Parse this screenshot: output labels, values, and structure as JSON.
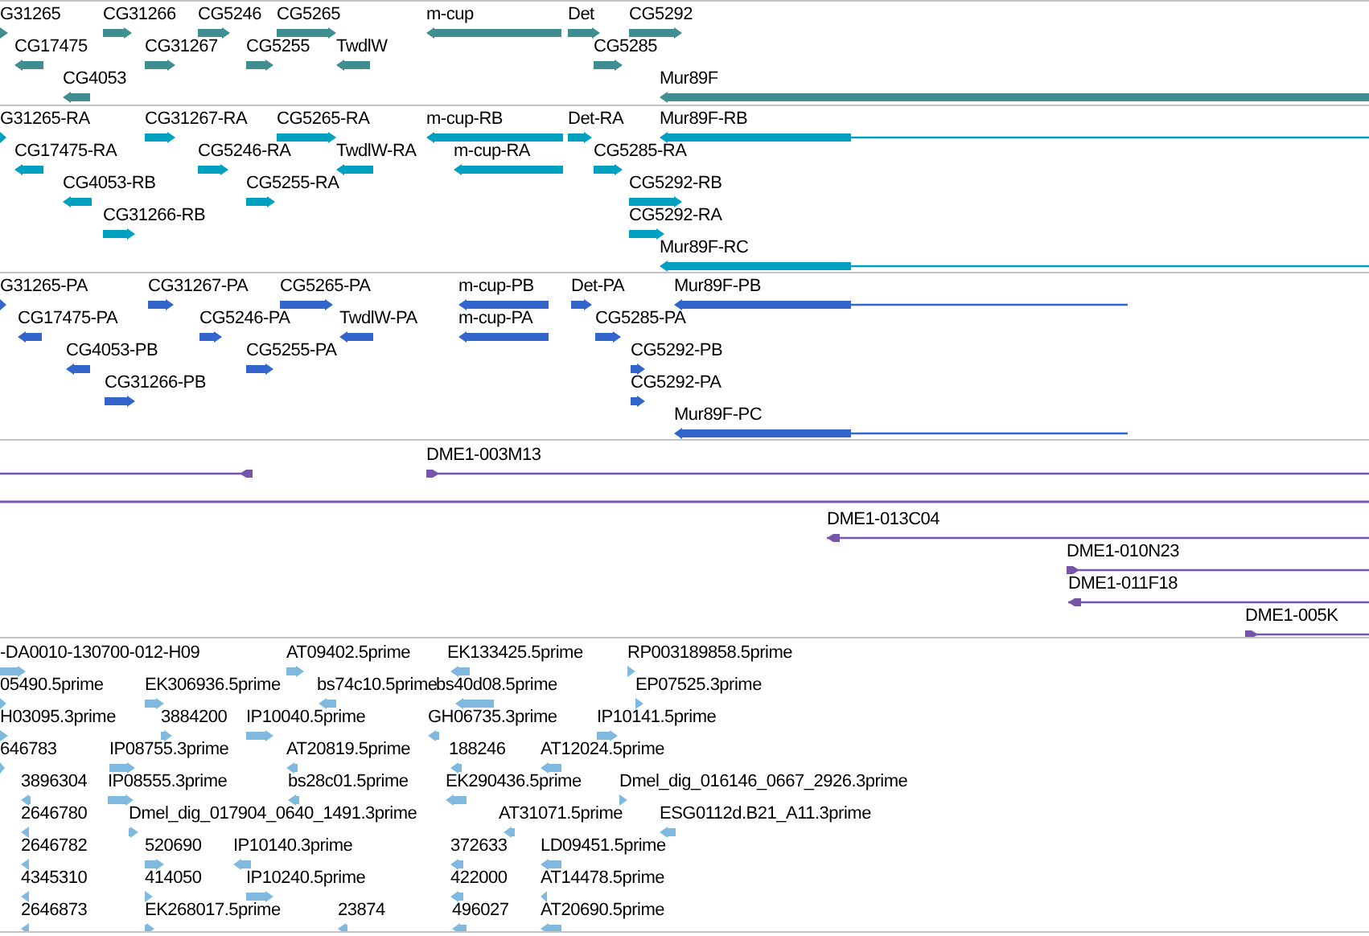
{
  "tracks": [
    {
      "kind": "gene",
      "features": [
        {
          "label": "G31265",
          "reverse": false
        },
        {
          "label": "CG31266",
          "reverse": false
        },
        {
          "label": "CG5246",
          "reverse": false
        },
        {
          "label": "CG5265",
          "reverse": false
        },
        {
          "label": "m-cup",
          "reverse": true
        },
        {
          "label": "Det",
          "reverse": false
        },
        {
          "label": "CG5292",
          "reverse": false
        },
        {
          "label": "CG17475",
          "reverse": true
        },
        {
          "label": "CG31267",
          "reverse": false
        },
        {
          "label": "CG5255",
          "reverse": false
        },
        {
          "label": "TwdlW",
          "reverse": true
        },
        {
          "label": "CG5285",
          "reverse": false
        },
        {
          "label": "CG4053",
          "reverse": true
        },
        {
          "label": "Mur89F",
          "reverse": true
        }
      ]
    },
    {
      "kind": "mrna",
      "features": [
        {
          "label": "G31265-RA",
          "reverse": false
        },
        {
          "label": "CG31267-RA",
          "reverse": false
        },
        {
          "label": "CG5265-RA",
          "reverse": false
        },
        {
          "label": "m-cup-RB",
          "reverse": true
        },
        {
          "label": "Det-RA",
          "reverse": false
        },
        {
          "label": "Mur89F-RB",
          "reverse": true
        },
        {
          "label": "CG17475-RA",
          "reverse": true
        },
        {
          "label": "CG5246-RA",
          "reverse": false
        },
        {
          "label": "TwdlW-RA",
          "reverse": true
        },
        {
          "label": "m-cup-RA",
          "reverse": true
        },
        {
          "label": "CG5285-RA",
          "reverse": false
        },
        {
          "label": "CG4053-RB",
          "reverse": true
        },
        {
          "label": "CG5255-RA",
          "reverse": false
        },
        {
          "label": "CG5292-RB",
          "reverse": false
        },
        {
          "label": "CG31266-RB",
          "reverse": false
        },
        {
          "label": "CG5292-RA",
          "reverse": false
        },
        {
          "label": "Mur89F-RC",
          "reverse": true
        }
      ]
    },
    {
      "kind": "protein",
      "features": [
        {
          "label": "G31265-PA",
          "reverse": false
        },
        {
          "label": "CG31267-PA",
          "reverse": false
        },
        {
          "label": "CG5265-PA",
          "reverse": false
        },
        {
          "label": "m-cup-PB",
          "reverse": true
        },
        {
          "label": "Det-PA",
          "reverse": false
        },
        {
          "label": "Mur89F-PB",
          "reverse": true
        },
        {
          "label": "CG17475-PA",
          "reverse": true
        },
        {
          "label": "CG5246-PA",
          "reverse": false
        },
        {
          "label": "TwdlW-PA",
          "reverse": true
        },
        {
          "label": "m-cup-PA",
          "reverse": true
        },
        {
          "label": "CG5285-PA",
          "reverse": false
        },
        {
          "label": "CG4053-PB",
          "reverse": true
        },
        {
          "label": "CG5255-PA",
          "reverse": false
        },
        {
          "label": "CG5292-PB",
          "reverse": false
        },
        {
          "label": "CG31266-PB",
          "reverse": false
        },
        {
          "label": "CG5292-PA",
          "reverse": false
        },
        {
          "label": "Mur89F-PC",
          "reverse": true
        }
      ]
    },
    {
      "kind": "clone",
      "features": [
        {
          "reverse": true
        },
        {
          "label": "DME1-003M13",
          "reverse": false
        },
        {
          "label": "DME1-013C04",
          "reverse": true
        },
        {
          "label": "DME1-010N23",
          "reverse": false
        },
        {
          "label": "DME1-011F18",
          "reverse": true
        },
        {
          "label": "DME1-005K",
          "reverse": false
        }
      ]
    },
    {
      "kind": "est",
      "features": [
        {
          "label": "-DA0010-130700-012-H09",
          "reverse": false
        },
        {
          "label": "AT09402.5prime",
          "reverse": false
        },
        {
          "label": "EK133425.5prime",
          "reverse": true
        },
        {
          "label": "RP003189858.5prime",
          "reverse": false
        },
        {
          "label": "05490.5prime",
          "reverse": false
        },
        {
          "label": "EK306936.5prime",
          "reverse": false
        },
        {
          "label": "bs74c10.5prime",
          "reverse": true
        },
        {
          "label": "bs40d08.5prime",
          "reverse": true
        },
        {
          "label": "EP07525.3prime",
          "reverse": false
        },
        {
          "label": "H03095.3prime",
          "reverse": false
        },
        {
          "label": "3884200",
          "reverse": false
        },
        {
          "label": "IP10040.5prime",
          "reverse": false
        },
        {
          "label": "GH06735.3prime",
          "reverse": true
        },
        {
          "label": "IP10141.5prime",
          "reverse": false
        },
        {
          "label": "646783",
          "reverse": false
        },
        {
          "label": "IP08755.3prime",
          "reverse": false
        },
        {
          "label": "AT20819.5prime",
          "reverse": true
        },
        {
          "label": "188246",
          "reverse": true
        },
        {
          "label": "AT12024.5prime",
          "reverse": true
        },
        {
          "label": "3896304",
          "reverse": true
        },
        {
          "label": "IP08555.3prime",
          "reverse": false
        },
        {
          "label": "bs28c01.5prime",
          "reverse": true
        },
        {
          "label": "EK290436.5prime",
          "reverse": true
        },
        {
          "label": "Dmel_dig_016146_0667_2926.3prime",
          "reverse": false
        },
        {
          "label": "2646780",
          "reverse": true
        },
        {
          "label": "Dmel_dig_017904_0640_1491.3prime",
          "reverse": false
        },
        {
          "label": "AT31071.5prime",
          "reverse": true
        },
        {
          "label": "ESG0112d.B21_A11.3prime",
          "reverse": true
        },
        {
          "label": "2646782",
          "reverse": true
        },
        {
          "label": "520690",
          "reverse": false
        },
        {
          "label": "IP10140.3prime",
          "reverse": true
        },
        {
          "label": "372633",
          "reverse": true
        },
        {
          "label": "LD09451.5prime",
          "reverse": true
        },
        {
          "label": "4345310",
          "reverse": true
        },
        {
          "label": "414050",
          "reverse": false
        },
        {
          "label": "IP10240.5prime",
          "reverse": false
        },
        {
          "label": "422000",
          "reverse": true
        },
        {
          "label": "AT14478.5prime",
          "reverse": true
        },
        {
          "label": "2646873",
          "reverse": true
        },
        {
          "label": "EK268017.5prime",
          "reverse": false
        },
        {
          "label": "23874",
          "reverse": true
        },
        {
          "label": "496027",
          "reverse": true
        },
        {
          "label": "AT20690.5prime",
          "reverse": true
        }
      ]
    }
  ]
}
